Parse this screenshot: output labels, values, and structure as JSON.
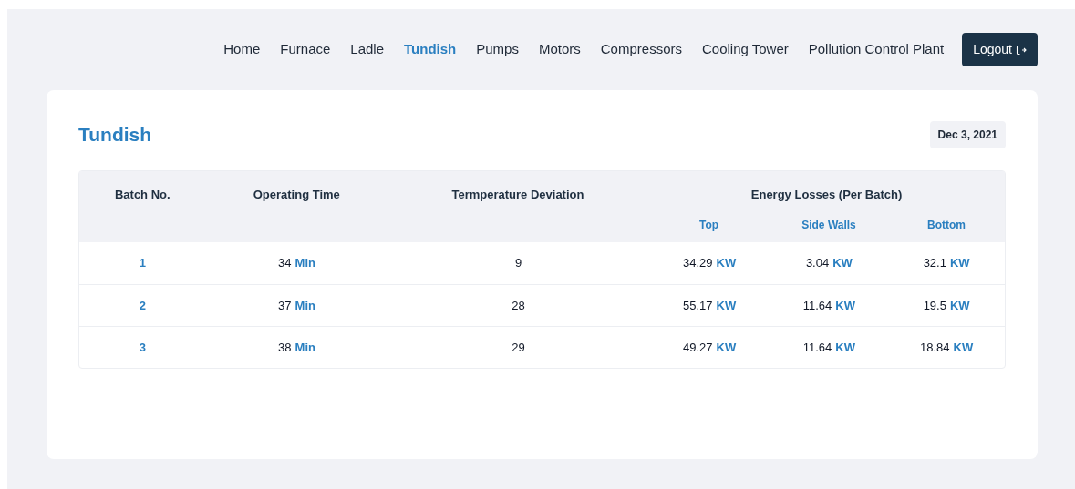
{
  "nav": {
    "items": [
      {
        "label": "Home",
        "selected": false
      },
      {
        "label": "Furnace",
        "selected": false
      },
      {
        "label": "Ladle",
        "selected": false
      },
      {
        "label": "Tundish",
        "selected": true
      },
      {
        "label": "Pumps",
        "selected": false
      },
      {
        "label": "Motors",
        "selected": false
      },
      {
        "label": "Compressors",
        "selected": false
      },
      {
        "label": "Cooling Tower",
        "selected": false
      },
      {
        "label": "Pollution Control Plant",
        "selected": false
      }
    ],
    "logout": "Logout"
  },
  "card": {
    "title": "Tundish",
    "date": "Dec 3, 2021"
  },
  "table": {
    "columns": [
      "Batch No.",
      "Operating Time",
      "Termperature Deviation"
    ],
    "group_header": "Energy Losses (Per Batch)",
    "sub_columns": [
      "Top",
      "Side Walls",
      "Bottom"
    ],
    "rows": [
      {
        "batch": "1",
        "operating_time": {
          "value": "34",
          "unit": "Min"
        },
        "temperature_deviation": "9",
        "losses": [
          {
            "value": "34.29",
            "unit": "KW"
          },
          {
            "value": "3.04",
            "unit": "KW"
          },
          {
            "value": "32.1",
            "unit": "KW"
          }
        ]
      },
      {
        "batch": "2",
        "operating_time": {
          "value": "37",
          "unit": "Min"
        },
        "temperature_deviation": "28",
        "losses": [
          {
            "value": "55.17",
            "unit": "KW"
          },
          {
            "value": "11.64",
            "unit": "KW"
          },
          {
            "value": "19.5",
            "unit": "KW"
          }
        ]
      },
      {
        "batch": "3",
        "operating_time": {
          "value": "38",
          "unit": "Min"
        },
        "temperature_deviation": "29",
        "losses": [
          {
            "value": "49.27",
            "unit": "KW"
          },
          {
            "value": "11.64",
            "unit": "KW"
          },
          {
            "value": "18.84",
            "unit": "KW"
          }
        ]
      }
    ]
  }
}
